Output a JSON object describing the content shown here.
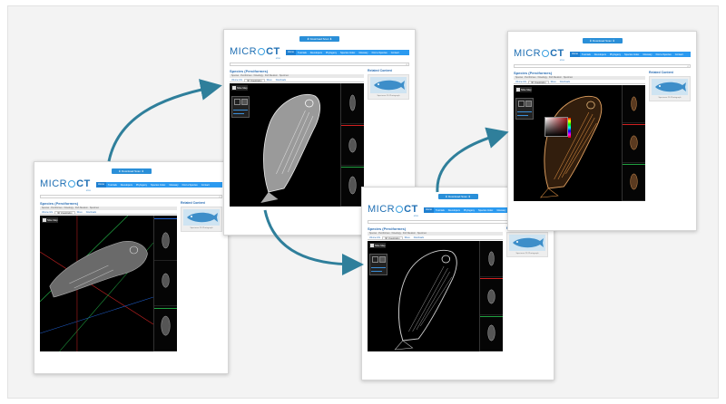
{
  "colors": {
    "arrow": "#2f7f9b",
    "accent": "#2b9af0",
    "brand": "#1f6fb3",
    "slice_red": "#d02020",
    "slice_green": "#20a040",
    "slice_blue": "#2060d0"
  },
  "icons": [
    "search-icon",
    "download-icon",
    "mode-icon"
  ],
  "screenshots": [
    {
      "download_label": "⬇ Download Scan ⬇",
      "logo": {
        "micro": "MICR",
        "ct": "CT",
        "tag": "atlas"
      },
      "nav": [
        "Home",
        "Tutorials",
        "Developers",
        "Phylogeny",
        "Species Index",
        "Glossary",
        "Find a Species",
        "Contact"
      ],
      "species_title": "Species (Perciformes)",
      "breadcrumb": "Species · Perciformes · Osteology · Fish Skeleton · Specimen",
      "tabs": [
        "Volume Info",
        "3D Visualization",
        "Slices",
        "Downloads"
      ],
      "mode_label": "Slice Map",
      "related_title": "Related Content",
      "related_caption": "Specimen 2D Photograph"
    },
    {
      "download_label": "⬇ Download Scan ⬇",
      "logo": {
        "micro": "MICR",
        "ct": "CT",
        "tag": "atlas"
      },
      "nav": [
        "Home",
        "Tutorials",
        "Developers",
        "Phylogeny",
        "Species Index",
        "Glossary",
        "Find a Species",
        "Contact"
      ],
      "species_title": "Species (Perciformes)",
      "breadcrumb": "Species · Perciformes · Osteology · Fish Skeleton · Specimen",
      "tabs": [
        "Volume Info",
        "3D Visualization",
        "Slices",
        "Downloads"
      ],
      "mode_label": "Slice Map",
      "related_title": "Related Content",
      "related_caption": "Specimen 2D Photograph"
    },
    {
      "download_label": "⬇ Download Scan ⬇",
      "logo": {
        "micro": "MICR",
        "ct": "CT",
        "tag": "atlas"
      },
      "nav": [
        "Home",
        "Tutorials",
        "Developers",
        "Phylogeny",
        "Species Index",
        "Glossary",
        "Find a Species",
        "Contact"
      ],
      "species_title": "Species (Perciformes)",
      "breadcrumb": "Species · Perciformes · Osteology · Fish Skeleton · Specimen",
      "tabs": [
        "Volume Info",
        "3D Visualization",
        "Slices",
        "Downloads"
      ],
      "mode_label": "Slice Map",
      "related_title": "Related Content",
      "related_caption": "Specimen 2D Photograph"
    },
    {
      "download_label": "⬇ Download Scan ⬇",
      "logo": {
        "micro": "MICR",
        "ct": "CT",
        "tag": "atlas"
      },
      "nav": [
        "Home",
        "Tutorials",
        "Developers",
        "Phylogeny",
        "Species Index",
        "Glossary",
        "Find a Species",
        "Contact"
      ],
      "species_title": "Species (Perciformes)",
      "breadcrumb": "Species · Perciformes · Osteology · Fish Skeleton · Specimen",
      "tabs": [
        "Volume Info",
        "3D Visualization",
        "Slices",
        "Downloads"
      ],
      "mode_label": "Slice Map",
      "related_title": "Related Content",
      "related_caption": "Specimen 2D Photograph"
    }
  ]
}
